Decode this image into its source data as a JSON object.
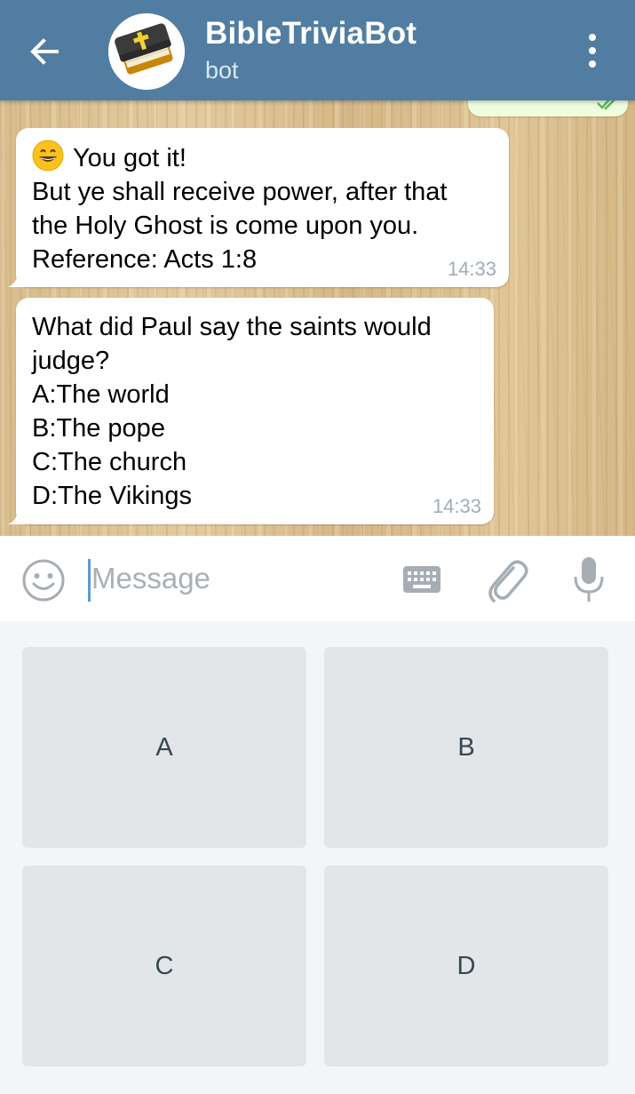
{
  "header": {
    "title": "BibleTriviaBot",
    "subtitle": "bot"
  },
  "messages": [
    {
      "from": "bot",
      "emoji": "grinning-face",
      "lines": [
        "You got it!",
        "But ye shall receive power, after that",
        "the Holy Ghost is come upon you.",
        "Reference: Acts 1:8"
      ],
      "time": "14:33"
    },
    {
      "from": "bot",
      "lines": [
        "What did Paul say the saints would",
        "judge?",
        "A:The world",
        "B:The pope",
        "C:The church",
        "D:The Vikings"
      ],
      "time": "14:33"
    }
  ],
  "composer": {
    "placeholder": "Message"
  },
  "reply_keyboard": {
    "buttons": [
      "A",
      "B",
      "C",
      "D"
    ]
  },
  "colors": {
    "header": "#517da2",
    "outgoing_bubble": "#effdde",
    "keyboard_button": "#e3e6e9",
    "caret": "#5b9bd1"
  }
}
